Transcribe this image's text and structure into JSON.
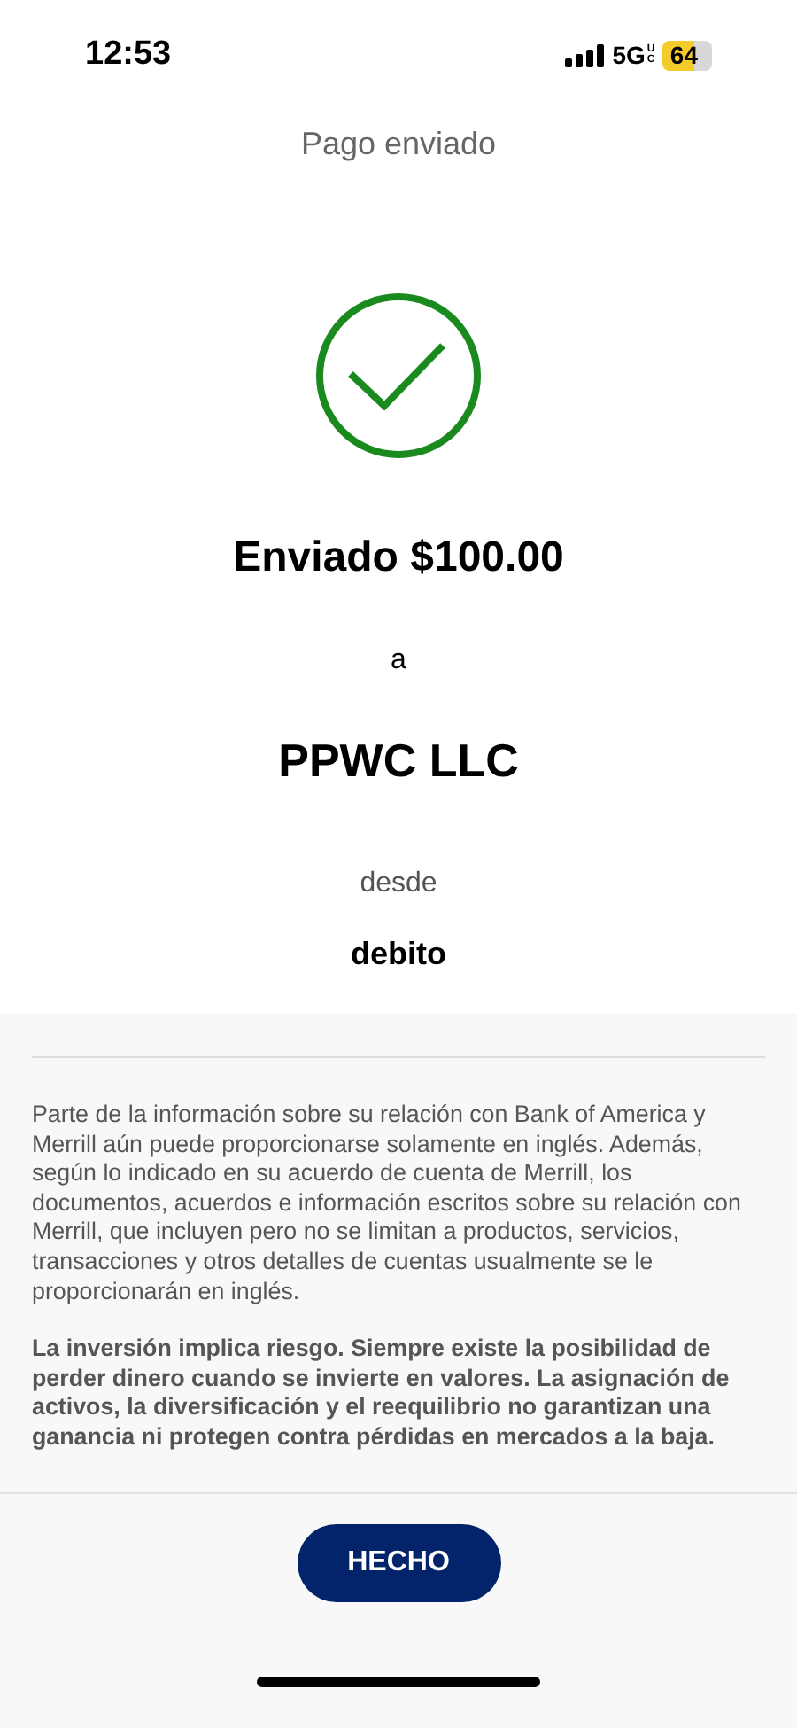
{
  "status_bar": {
    "time": "12:53",
    "network": "5G",
    "network_suffix": "UC",
    "battery": "64"
  },
  "header": {
    "title": "Pago enviado"
  },
  "confirmation": {
    "amount_line": "Enviado $100.00",
    "connector": "a",
    "recipient": "PPWC LLC",
    "from_label": "desde",
    "account": "debito"
  },
  "disclosures": [
    {
      "kind": "normal",
      "text": "Parte de la información sobre su relación con Bank of America y Merrill aún puede proporcionarse solamente en inglés. Además, según lo indicado en su acuerdo de cuenta de Merrill, los documentos, acuerdos e información escritos sobre su relación con Merrill, que incluyen pero no se limitan a productos, servicios, transacciones y otros detalles de cuentas usualmente se le proporcionarán en inglés."
    },
    {
      "kind": "bold",
      "text": "La inversión implica riesgo. Siempre existe la posibilidad de perder dinero cuando se invierte en valores. La asignación de activos, la diversificación y el reequilibrio no garantizan una ganancia ni protegen contra pérdidas en mercados a la baja."
    }
  ],
  "button": {
    "label": "HECHO"
  }
}
